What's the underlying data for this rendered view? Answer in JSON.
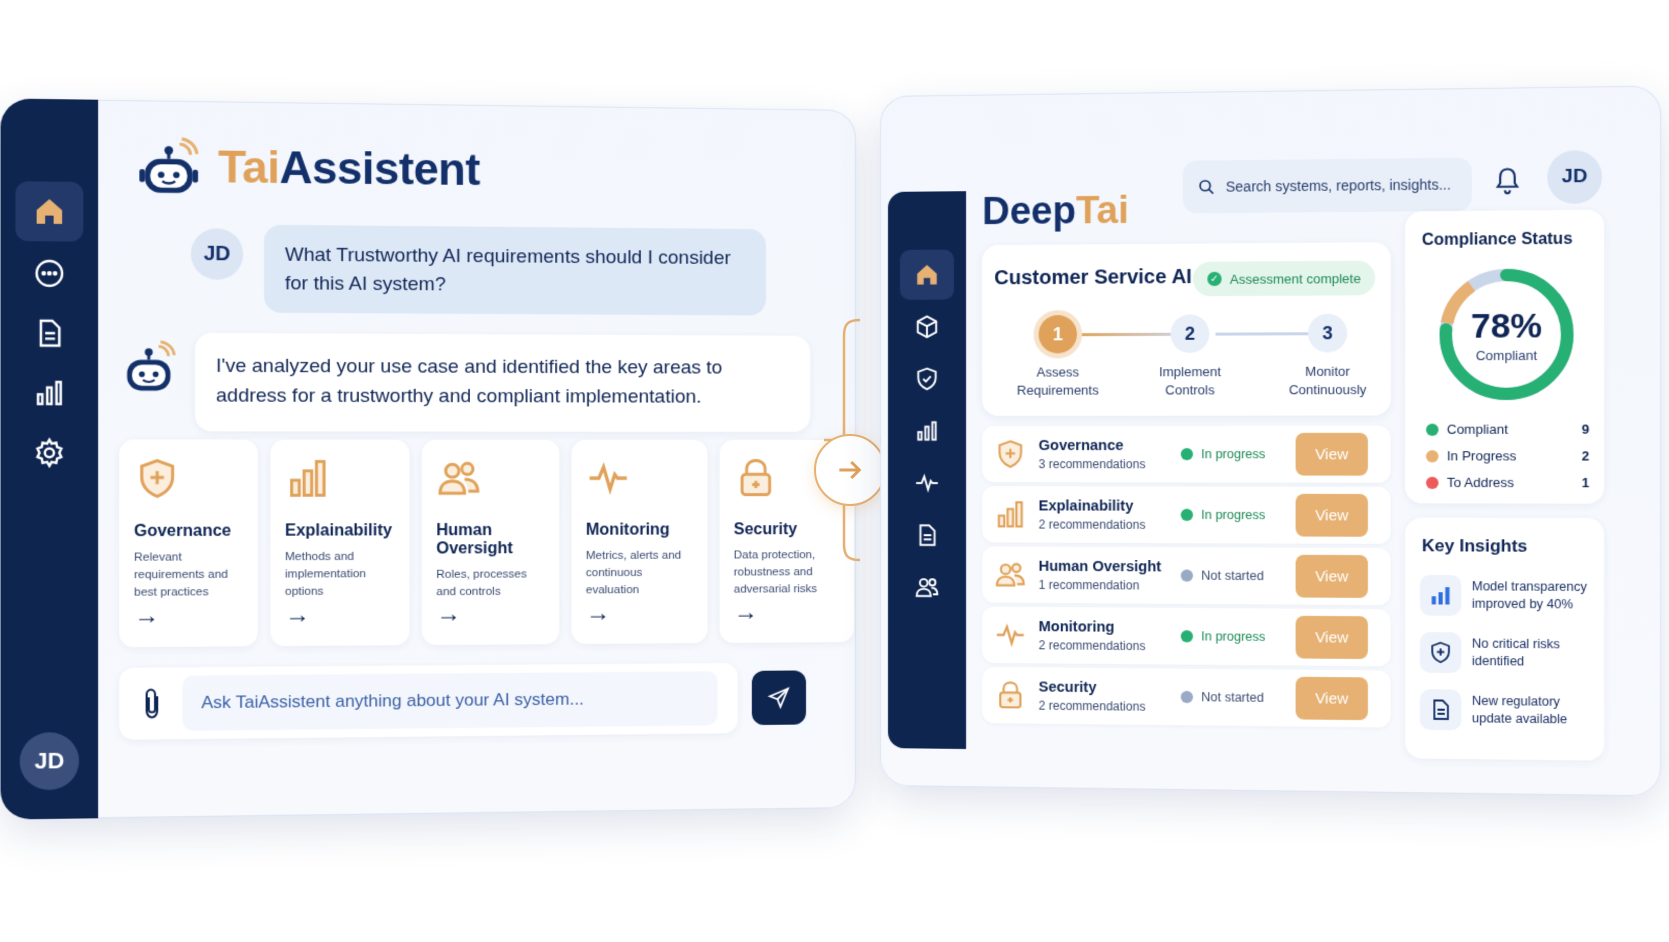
{
  "assistant": {
    "brand_prefix": "Tai",
    "brand_suffix": "Assistent",
    "user_initials": "JD",
    "user_message": "What Trustworthy AI requirements should I consider for this AI system?",
    "bot_message": "I've analyzed your use case and identified the key areas to address for a trustworthy and compliant implementation.",
    "cards": [
      {
        "title": "Governance",
        "desc": "Relevant requirements and best practices",
        "icon": "shield-plus-icon"
      },
      {
        "title": "Explainability",
        "desc": "Methods and implementation options",
        "icon": "bar-chart-icon"
      },
      {
        "title": "Human Oversight",
        "desc": "Roles, processes and controls",
        "icon": "users-icon"
      },
      {
        "title": "Monitoring",
        "desc": "Metrics, alerts and continuous evaluation",
        "icon": "pulse-icon"
      },
      {
        "title": "Security",
        "desc": "Data protection, robustness and adversarial risks",
        "icon": "lock-icon"
      }
    ],
    "card_arrow": "→",
    "input_placeholder": "Ask TaiAssistent anything about your AI system...",
    "sidebar_avatar": "JD"
  },
  "dashboard": {
    "brand_prefix": "Deep",
    "brand_suffix": "Tai",
    "search_placeholder": "Search systems, reports, insights...",
    "user_initials": "JD",
    "system_name": "Customer Service AI",
    "assessment_badge": "Assessment complete",
    "steps": [
      {
        "num": "1",
        "label1": "Assess",
        "label2": "Requirements",
        "status": "done"
      },
      {
        "num": "2",
        "label1": "Implement",
        "label2": "Controls",
        "status": "todo"
      },
      {
        "num": "3",
        "label1": "Monitor",
        "label2": "Continuously",
        "status": "todo"
      }
    ],
    "recommendations": [
      {
        "title": "Governance",
        "sub": "3 recommendations",
        "status": "In progress",
        "status_color": "#27b073",
        "status_text_color": "#1d8a57",
        "icon": "shield-plus-icon"
      },
      {
        "title": "Explainability",
        "sub": "2 recommendations",
        "status": "In progress",
        "status_color": "#27b073",
        "status_text_color": "#1d8a57",
        "icon": "bar-chart-icon"
      },
      {
        "title": "Human Oversight",
        "sub": "1 recommendation",
        "status": "Not started",
        "status_color": "#9aa9c4",
        "status_text_color": "#3b4c72",
        "icon": "users-icon"
      },
      {
        "title": "Monitoring",
        "sub": "2 recommendations",
        "status": "In progress",
        "status_color": "#27b073",
        "status_text_color": "#1d8a57",
        "icon": "pulse-icon"
      },
      {
        "title": "Security",
        "sub": "2 recommendations",
        "status": "Not started",
        "status_color": "#9aa9c4",
        "status_text_color": "#3b4c72",
        "icon": "lock-icon"
      }
    ],
    "view_label": "View",
    "compliance": {
      "title": "Compliance Status",
      "percent_label": "78%",
      "percent": 78,
      "sub": "Compliant",
      "legend": [
        {
          "name": "Compliant",
          "value": "9",
          "color": "#27b073"
        },
        {
          "name": "In Progress",
          "value": "2",
          "color": "#e6b172"
        },
        {
          "name": "To Address",
          "value": "1",
          "color": "#ee5a5a"
        }
      ]
    },
    "insights": {
      "title": "Key Insights",
      "items": [
        {
          "text": "Model transparency improved by 40%",
          "icon": "bar-chart-icon"
        },
        {
          "text": "No critical risks identified",
          "icon": "shield-plus-icon"
        },
        {
          "text": "New regulatory update available",
          "icon": "document-icon"
        }
      ]
    }
  },
  "colors": {
    "navy": "#0e2550",
    "accent": "#e0a25a",
    "success": "#27b073",
    "danger": "#ee5a5a"
  }
}
